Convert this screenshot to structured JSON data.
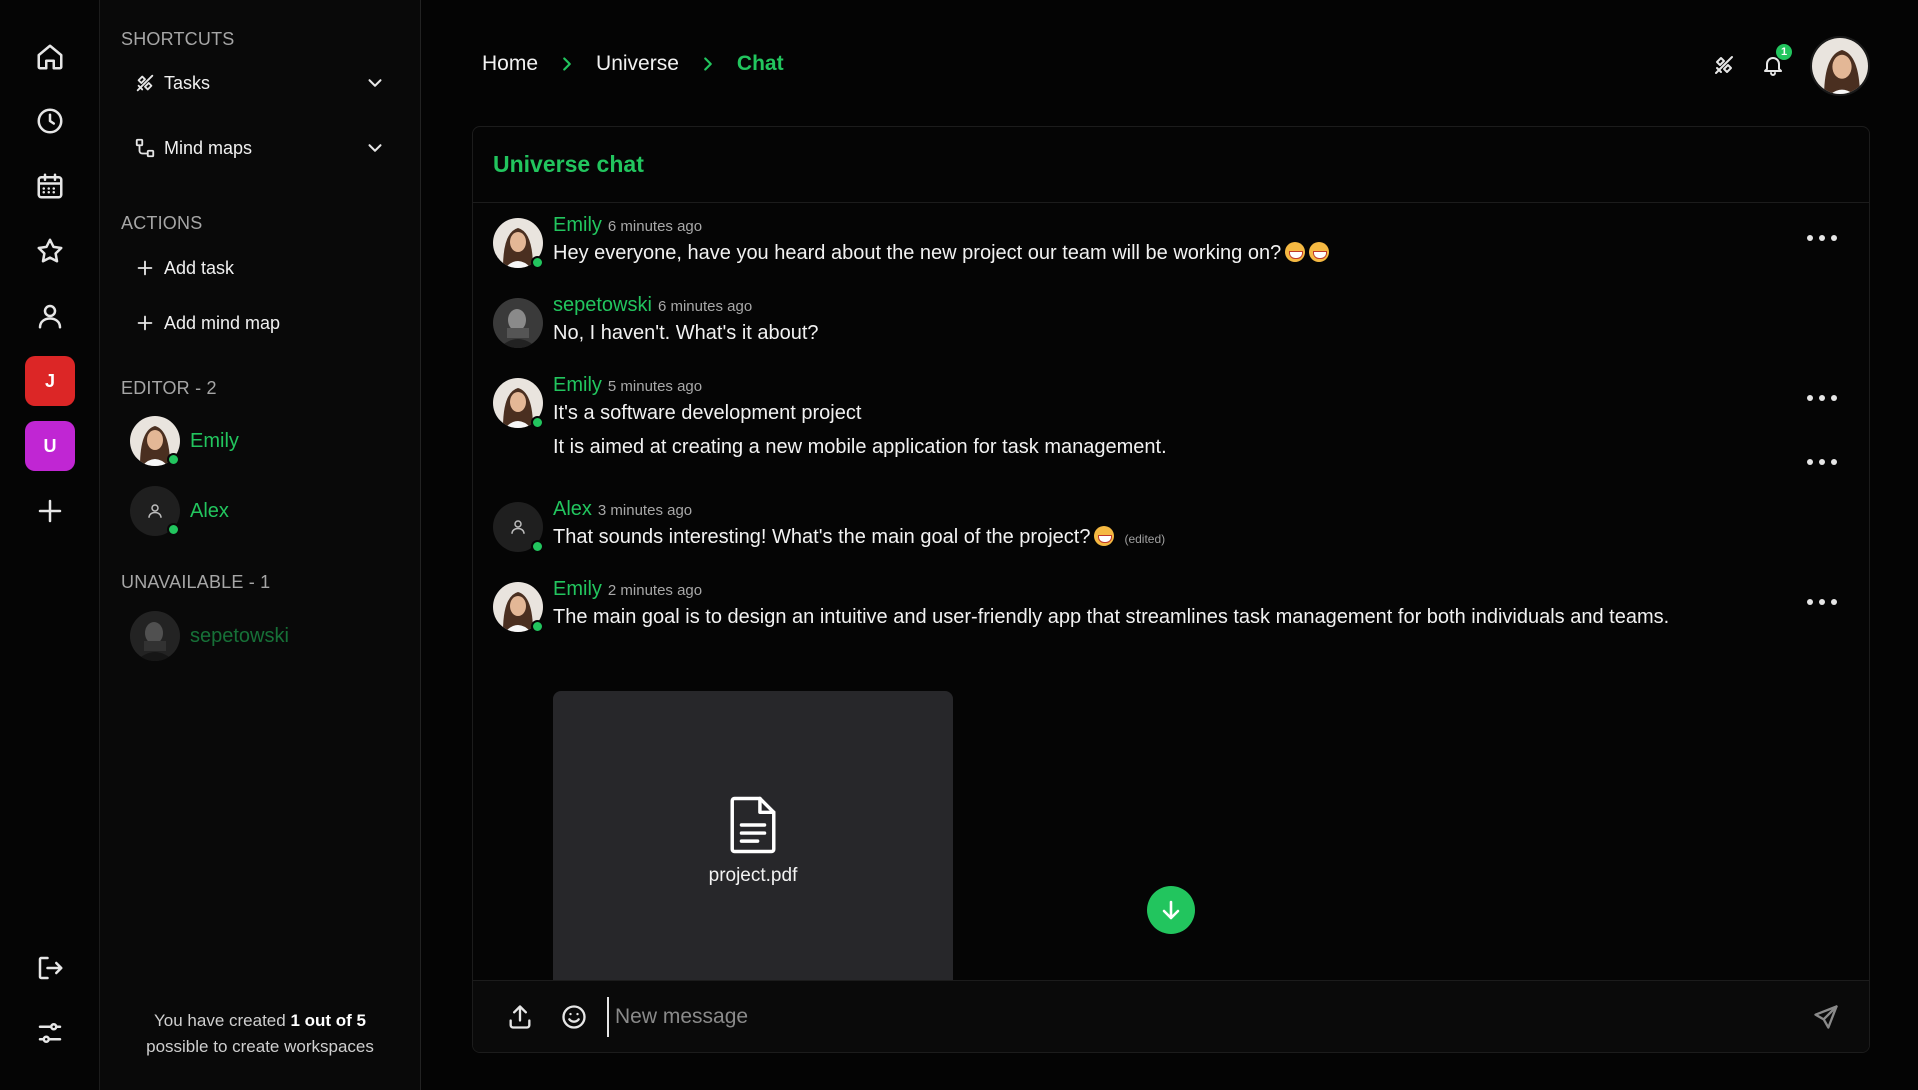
{
  "colors": {
    "accent": "#22c55e",
    "workspace_j": "#dc2626",
    "workspace_u": "#c026d3",
    "file_card": "#27272a"
  },
  "rail": {
    "icons": [
      "home-icon",
      "clock-icon",
      "calendar-icon",
      "star-icon",
      "user-icon"
    ],
    "workspaces": [
      {
        "letter": "J",
        "color": "#dc2626"
      },
      {
        "letter": "U",
        "color": "#c026d3"
      }
    ],
    "bottom_icons": [
      "logout-icon",
      "settings-sliders-icon"
    ]
  },
  "sidebar": {
    "shortcuts_title": "SHORTCUTS",
    "shortcuts": [
      {
        "label": "Tasks",
        "icon": "tasks-icon"
      },
      {
        "label": "Mind maps",
        "icon": "mind-map-icon"
      }
    ],
    "actions_title": "ACTIONS",
    "actions": [
      {
        "label": "Add task"
      },
      {
        "label": "Add mind map"
      }
    ],
    "editor_title": "EDITOR - 2",
    "editors": [
      {
        "name": "Emily",
        "online": true
      },
      {
        "name": "Alex",
        "online": true
      }
    ],
    "unavailable_title": "UNAVAILABLE - 1",
    "unavailable": [
      {
        "name": "sepetowski"
      }
    ],
    "footer_prefix": "You have created ",
    "footer_bold": "1 out of 5",
    "footer_suffix": "possible to create workspaces"
  },
  "header": {
    "breadcrumbs": [
      "Home",
      "Universe",
      "Chat"
    ],
    "notification_count": "1"
  },
  "chat": {
    "title": "Universe chat",
    "messages": [
      {
        "author": "Emily",
        "time": "6 minutes ago",
        "lines": [
          "Hey everyone, have you heard about the new project our team will be working on?"
        ]
      },
      {
        "author": "sepetowski",
        "time": "6 minutes ago",
        "lines": [
          "No, I haven't. What's it about?"
        ]
      },
      {
        "author": "Emily",
        "time": "5 minutes ago",
        "lines": [
          "It's a software development project",
          "It is aimed at creating a new mobile application for task management."
        ]
      },
      {
        "author": "Alex",
        "time": "3 minutes ago",
        "lines": [
          "That sounds interesting! What's the main goal of the project?"
        ],
        "edited": "(edited)"
      },
      {
        "author": "Emily",
        "time": "2 minutes ago",
        "lines": [
          "The main goal is to design an intuitive and user-friendly app that streamlines task management for both individuals and teams."
        ]
      }
    ],
    "attachment": {
      "name": "project.pdf"
    },
    "composer_placeholder": "New message"
  }
}
